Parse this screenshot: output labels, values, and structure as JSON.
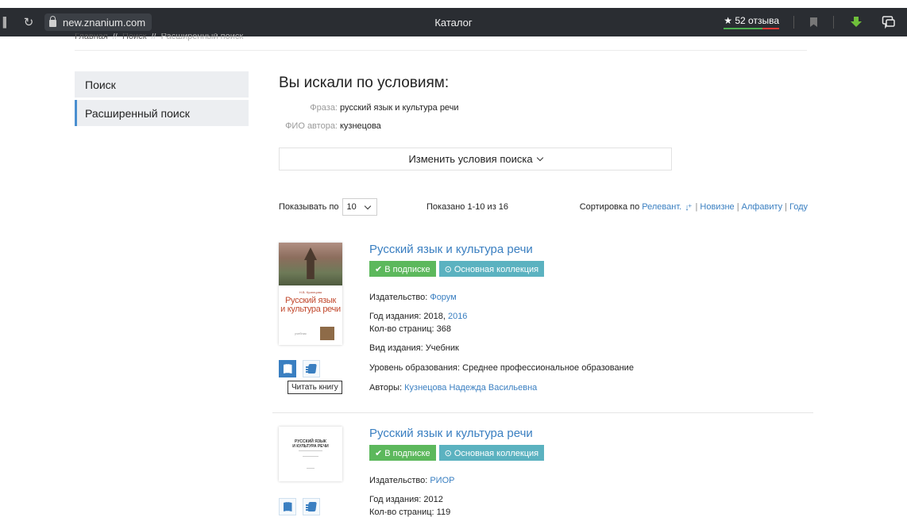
{
  "browser": {
    "url": "new.znanium.com",
    "title": "Каталог",
    "reviews": "★ 52 отзыва"
  },
  "breadcrumb": [
    "Главная",
    "Поиск",
    "Расширенный поиск"
  ],
  "sidebar": {
    "items": [
      {
        "label": "Поиск",
        "active": false
      },
      {
        "label": "Расширенный поиск",
        "active": true
      }
    ]
  },
  "search": {
    "title": "Вы искали по условиям:",
    "conditions": [
      {
        "label": "Фраза:",
        "value": "русский язык и культура речи"
      },
      {
        "label": "ФИО автора:",
        "value": "кузнецова"
      }
    ],
    "change_label": "Изменить условия поиска"
  },
  "controls": {
    "show_label": "Показывать по",
    "per_page": "10",
    "count_label": "Показано 1-10 из 16",
    "sort_label": "Сортировка по",
    "sort_options": [
      "Релевант.",
      "Новизне",
      "Алфавиту",
      "Году"
    ]
  },
  "results": [
    {
      "title": "Русский язык и культура речи",
      "badges": [
        "✔ В подписке",
        "⊙ Основная коллекция"
      ],
      "publisher_label": "Издательство:",
      "publisher": "Форум",
      "year_label": "Год издания:",
      "year": "2018,",
      "year_alt": "2016",
      "pages_label": "Кол-во страниц:",
      "pages": "368",
      "type_label": "Вид издания:",
      "type": "Учебник",
      "level_label": "Уровень образования:",
      "level": "Среднее профессиональное образование",
      "authors_label": "Авторы:",
      "authors": "Кузнецова Надежда Васильевна",
      "cover": {
        "author": "Н.В. Кузнецова",
        "title_line1": "Русский язык",
        "title_line2": "и культура речи",
        "sub": "учебник"
      },
      "tooltip": "Читать книгу"
    },
    {
      "title": "Русский язык и культура речи",
      "badges": [
        "✔ В подписке",
        "⊙ Основная коллекция"
      ],
      "publisher_label": "Издательство:",
      "publisher": "РИОР",
      "year_label": "Год издания:",
      "year": "2012",
      "pages_label": "Кол-во страниц:",
      "pages": "119",
      "cover": {
        "title_line1": "РУССКИЙ ЯЗЫК",
        "title_line2": "И КУЛЬТУРА РЕЧИ"
      }
    }
  ],
  "colors": {
    "link": "#3a7fc1",
    "badge_green": "#5cb85c",
    "badge_teal": "#5bb2c0",
    "topbar": "#2a2d32"
  }
}
